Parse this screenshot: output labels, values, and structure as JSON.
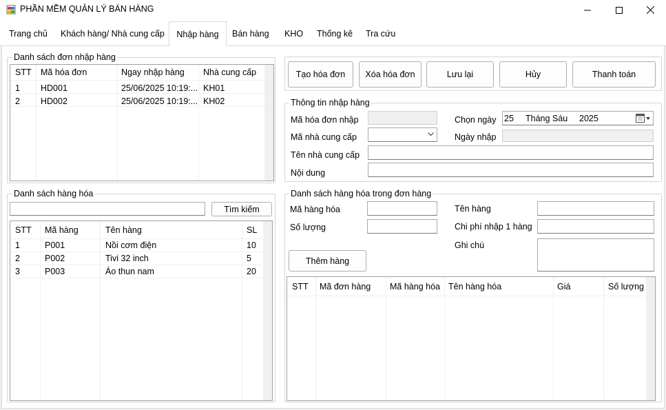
{
  "window": {
    "title": "PHẦN MỀM QUẢN LÝ BÁN HÀNG",
    "minimize": "—",
    "maximize": "☐",
    "close": "✕"
  },
  "tabs": [
    {
      "label": "Trang chủ"
    },
    {
      "label": "Khách hàng/ Nhà cung cấp"
    },
    {
      "label": "Nhập hàng"
    },
    {
      "label": "Bán hàng"
    },
    {
      "label": "KHO"
    },
    {
      "label": "Thống kê"
    },
    {
      "label": "Tra cứu"
    }
  ],
  "invoice_list": {
    "title": "Danh sách đơn nhập hàng",
    "columns": [
      "STT",
      "Mã hóa đơn",
      "Ngay nhập hàng",
      "Nhà cung cấp"
    ],
    "rows": [
      [
        "1",
        "HD001",
        "25/06/2025 10:19:...",
        "KH01"
      ],
      [
        "2",
        "HD002",
        "25/06/2025 10:19:...",
        "KH02"
      ]
    ]
  },
  "product_list": {
    "title": "Danh sách hàng hóa",
    "search_value": "",
    "search_button": "Tìm kiếm",
    "columns": [
      "STT",
      "Mã hàng",
      "Tên hàng",
      "SL"
    ],
    "rows": [
      [
        "1",
        "P001",
        "Nồi cơm điện",
        "10"
      ],
      [
        "2",
        "P002",
        "Tivi 32 inch",
        "5"
      ],
      [
        "3",
        "P003",
        "Áo thun nam",
        "20"
      ]
    ]
  },
  "actions": {
    "create": "Tạo hóa đơn",
    "delete": "Xóa hóa đơn",
    "save": "Lưu lại",
    "cancel": "Hủy",
    "pay": "Thanh toán"
  },
  "receipt_info": {
    "title": "Thông tin nhập hàng",
    "invoice_code_label": "Mã hóa đơn nhập",
    "invoice_code_value": "",
    "supplier_code_label": "Mã nhà cung cấp",
    "supplier_code_value": "",
    "supplier_name_label": "Tên nhà cung cấp",
    "supplier_name_value": "",
    "content_label": "Nội dung",
    "content_value": "",
    "pick_date_label": "Chọn ngày",
    "date_day": "25",
    "date_month": "Tháng Sáu",
    "date_year": "2025",
    "import_date_label": "Ngày nhập",
    "import_date_value": ""
  },
  "order_items": {
    "title": "Danh sách hàng hóa trong đơn hàng",
    "product_code_label": "Mã hàng hóa",
    "product_code_value": "",
    "quantity_label": "Số lượng",
    "quantity_value": "",
    "product_name_label": "Tên hàng",
    "product_name_value": "",
    "import_cost_label": "Chi phí nhập 1 hàng",
    "import_cost_value": "",
    "note_label": "Ghi chú",
    "note_value": "",
    "add_button": "Thêm hàng",
    "columns": [
      "STT",
      "Mã đơn hàng",
      "Mã hàng hóa",
      "Tên hàng hóa",
      "Giá",
      "Số lượng"
    ]
  }
}
